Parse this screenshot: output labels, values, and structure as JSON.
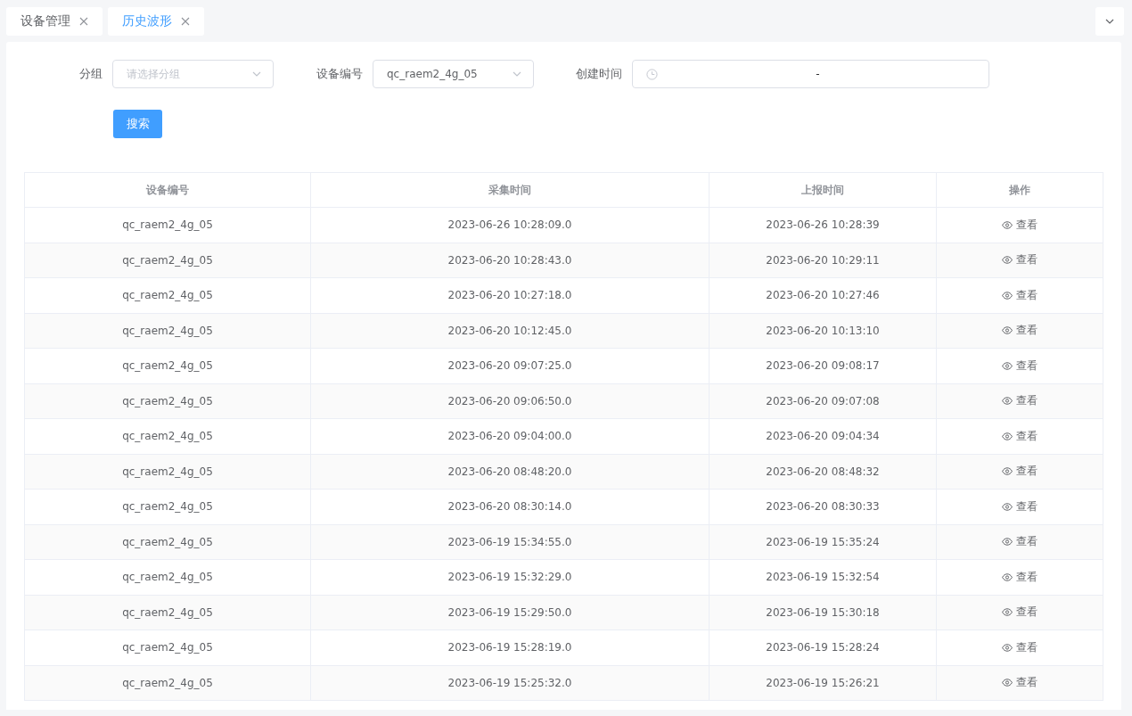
{
  "tabs": [
    {
      "label": "设备管理",
      "selected": false
    },
    {
      "label": "历史波形",
      "selected": true
    }
  ],
  "filters": {
    "group": {
      "label": "分组",
      "placeholder": "请选择分组"
    },
    "device": {
      "label": "设备编号",
      "value": "qc_raem2_4g_05"
    },
    "created": {
      "label": "创建时间",
      "separator": "-"
    }
  },
  "search_button": "搜索",
  "table": {
    "columns": [
      "设备编号",
      "采集时间",
      "上报时间",
      "操作"
    ],
    "rows": [
      {
        "device": "qc_raem2_4g_05",
        "collect_time": "2023-06-26 10:28:09.0",
        "report_time": "2023-06-26 10:28:39",
        "action": "查看"
      },
      {
        "device": "qc_raem2_4g_05",
        "collect_time": "2023-06-20 10:28:43.0",
        "report_time": "2023-06-20 10:29:11",
        "action": "查看"
      },
      {
        "device": "qc_raem2_4g_05",
        "collect_time": "2023-06-20 10:27:18.0",
        "report_time": "2023-06-20 10:27:46",
        "action": "查看"
      },
      {
        "device": "qc_raem2_4g_05",
        "collect_time": "2023-06-20 10:12:45.0",
        "report_time": "2023-06-20 10:13:10",
        "action": "查看"
      },
      {
        "device": "qc_raem2_4g_05",
        "collect_time": "2023-06-20 09:07:25.0",
        "report_time": "2023-06-20 09:08:17",
        "action": "查看"
      },
      {
        "device": "qc_raem2_4g_05",
        "collect_time": "2023-06-20 09:06:50.0",
        "report_time": "2023-06-20 09:07:08",
        "action": "查看"
      },
      {
        "device": "qc_raem2_4g_05",
        "collect_time": "2023-06-20 09:04:00.0",
        "report_time": "2023-06-20 09:04:34",
        "action": "查看"
      },
      {
        "device": "qc_raem2_4g_05",
        "collect_time": "2023-06-20 08:48:20.0",
        "report_time": "2023-06-20 08:48:32",
        "action": "查看"
      },
      {
        "device": "qc_raem2_4g_05",
        "collect_time": "2023-06-20 08:30:14.0",
        "report_time": "2023-06-20 08:30:33",
        "action": "查看"
      },
      {
        "device": "qc_raem2_4g_05",
        "collect_time": "2023-06-19 15:34:55.0",
        "report_time": "2023-06-19 15:35:24",
        "action": "查看"
      },
      {
        "device": "qc_raem2_4g_05",
        "collect_time": "2023-06-19 15:32:29.0",
        "report_time": "2023-06-19 15:32:54",
        "action": "查看"
      },
      {
        "device": "qc_raem2_4g_05",
        "collect_time": "2023-06-19 15:29:50.0",
        "report_time": "2023-06-19 15:30:18",
        "action": "查看"
      },
      {
        "device": "qc_raem2_4g_05",
        "collect_time": "2023-06-19 15:28:19.0",
        "report_time": "2023-06-19 15:28:24",
        "action": "查看"
      },
      {
        "device": "qc_raem2_4g_05",
        "collect_time": "2023-06-19 15:25:32.0",
        "report_time": "2023-06-19 15:26:21",
        "action": "查看"
      }
    ]
  }
}
